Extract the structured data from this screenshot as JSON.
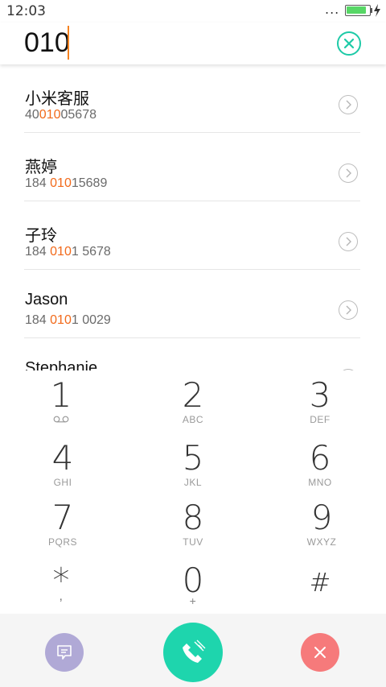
{
  "status_bar": {
    "time": "12:03",
    "signal_dots": "...",
    "battery_level": 0.9
  },
  "dial": {
    "number": "010"
  },
  "contacts": [
    {
      "name": "小米客服",
      "number_pre": "40",
      "number_match": "010",
      "number_post": "05678"
    },
    {
      "name": "燕婷",
      "number_pre": "184 ",
      "number_match": "010",
      "number_post": "15689"
    },
    {
      "name": "子玲",
      "number_pre": "184 ",
      "number_match": "010",
      "number_post": "1 5678"
    },
    {
      "name": "Jason",
      "number_pre": "184 ",
      "number_match": "010",
      "number_post": "1 0029"
    },
    {
      "name": "Stephanie",
      "number_pre": "",
      "number_match": "",
      "number_post": ""
    }
  ],
  "keypad": [
    {
      "digit": "1",
      "letters": ""
    },
    {
      "digit": "2",
      "letters": "ABC"
    },
    {
      "digit": "3",
      "letters": "DEF"
    },
    {
      "digit": "4",
      "letters": "GHI"
    },
    {
      "digit": "5",
      "letters": "JKL"
    },
    {
      "digit": "6",
      "letters": "MNO"
    },
    {
      "digit": "7",
      "letters": "PQRS"
    },
    {
      "digit": "8",
      "letters": "TUV"
    },
    {
      "digit": "9",
      "letters": "WXYZ"
    },
    {
      "digit": "*",
      "letters": ","
    },
    {
      "digit": "0",
      "letters": "+"
    },
    {
      "digit": "#",
      "letters": ""
    }
  ],
  "icons": {
    "clear": "close-circle-icon",
    "contact_detail": "chevron-right-icon",
    "voicemail": "voicemail-icon",
    "message": "message-icon",
    "call": "phone-call-icon",
    "delete": "close-icon"
  },
  "colors": {
    "accent": "#1dcaa7",
    "call_button": "#1ed5ad",
    "message_button": "#b0a9d6",
    "delete_button": "#f67a7b",
    "match_highlight": "#f26a1b",
    "caret": "#f58220"
  }
}
